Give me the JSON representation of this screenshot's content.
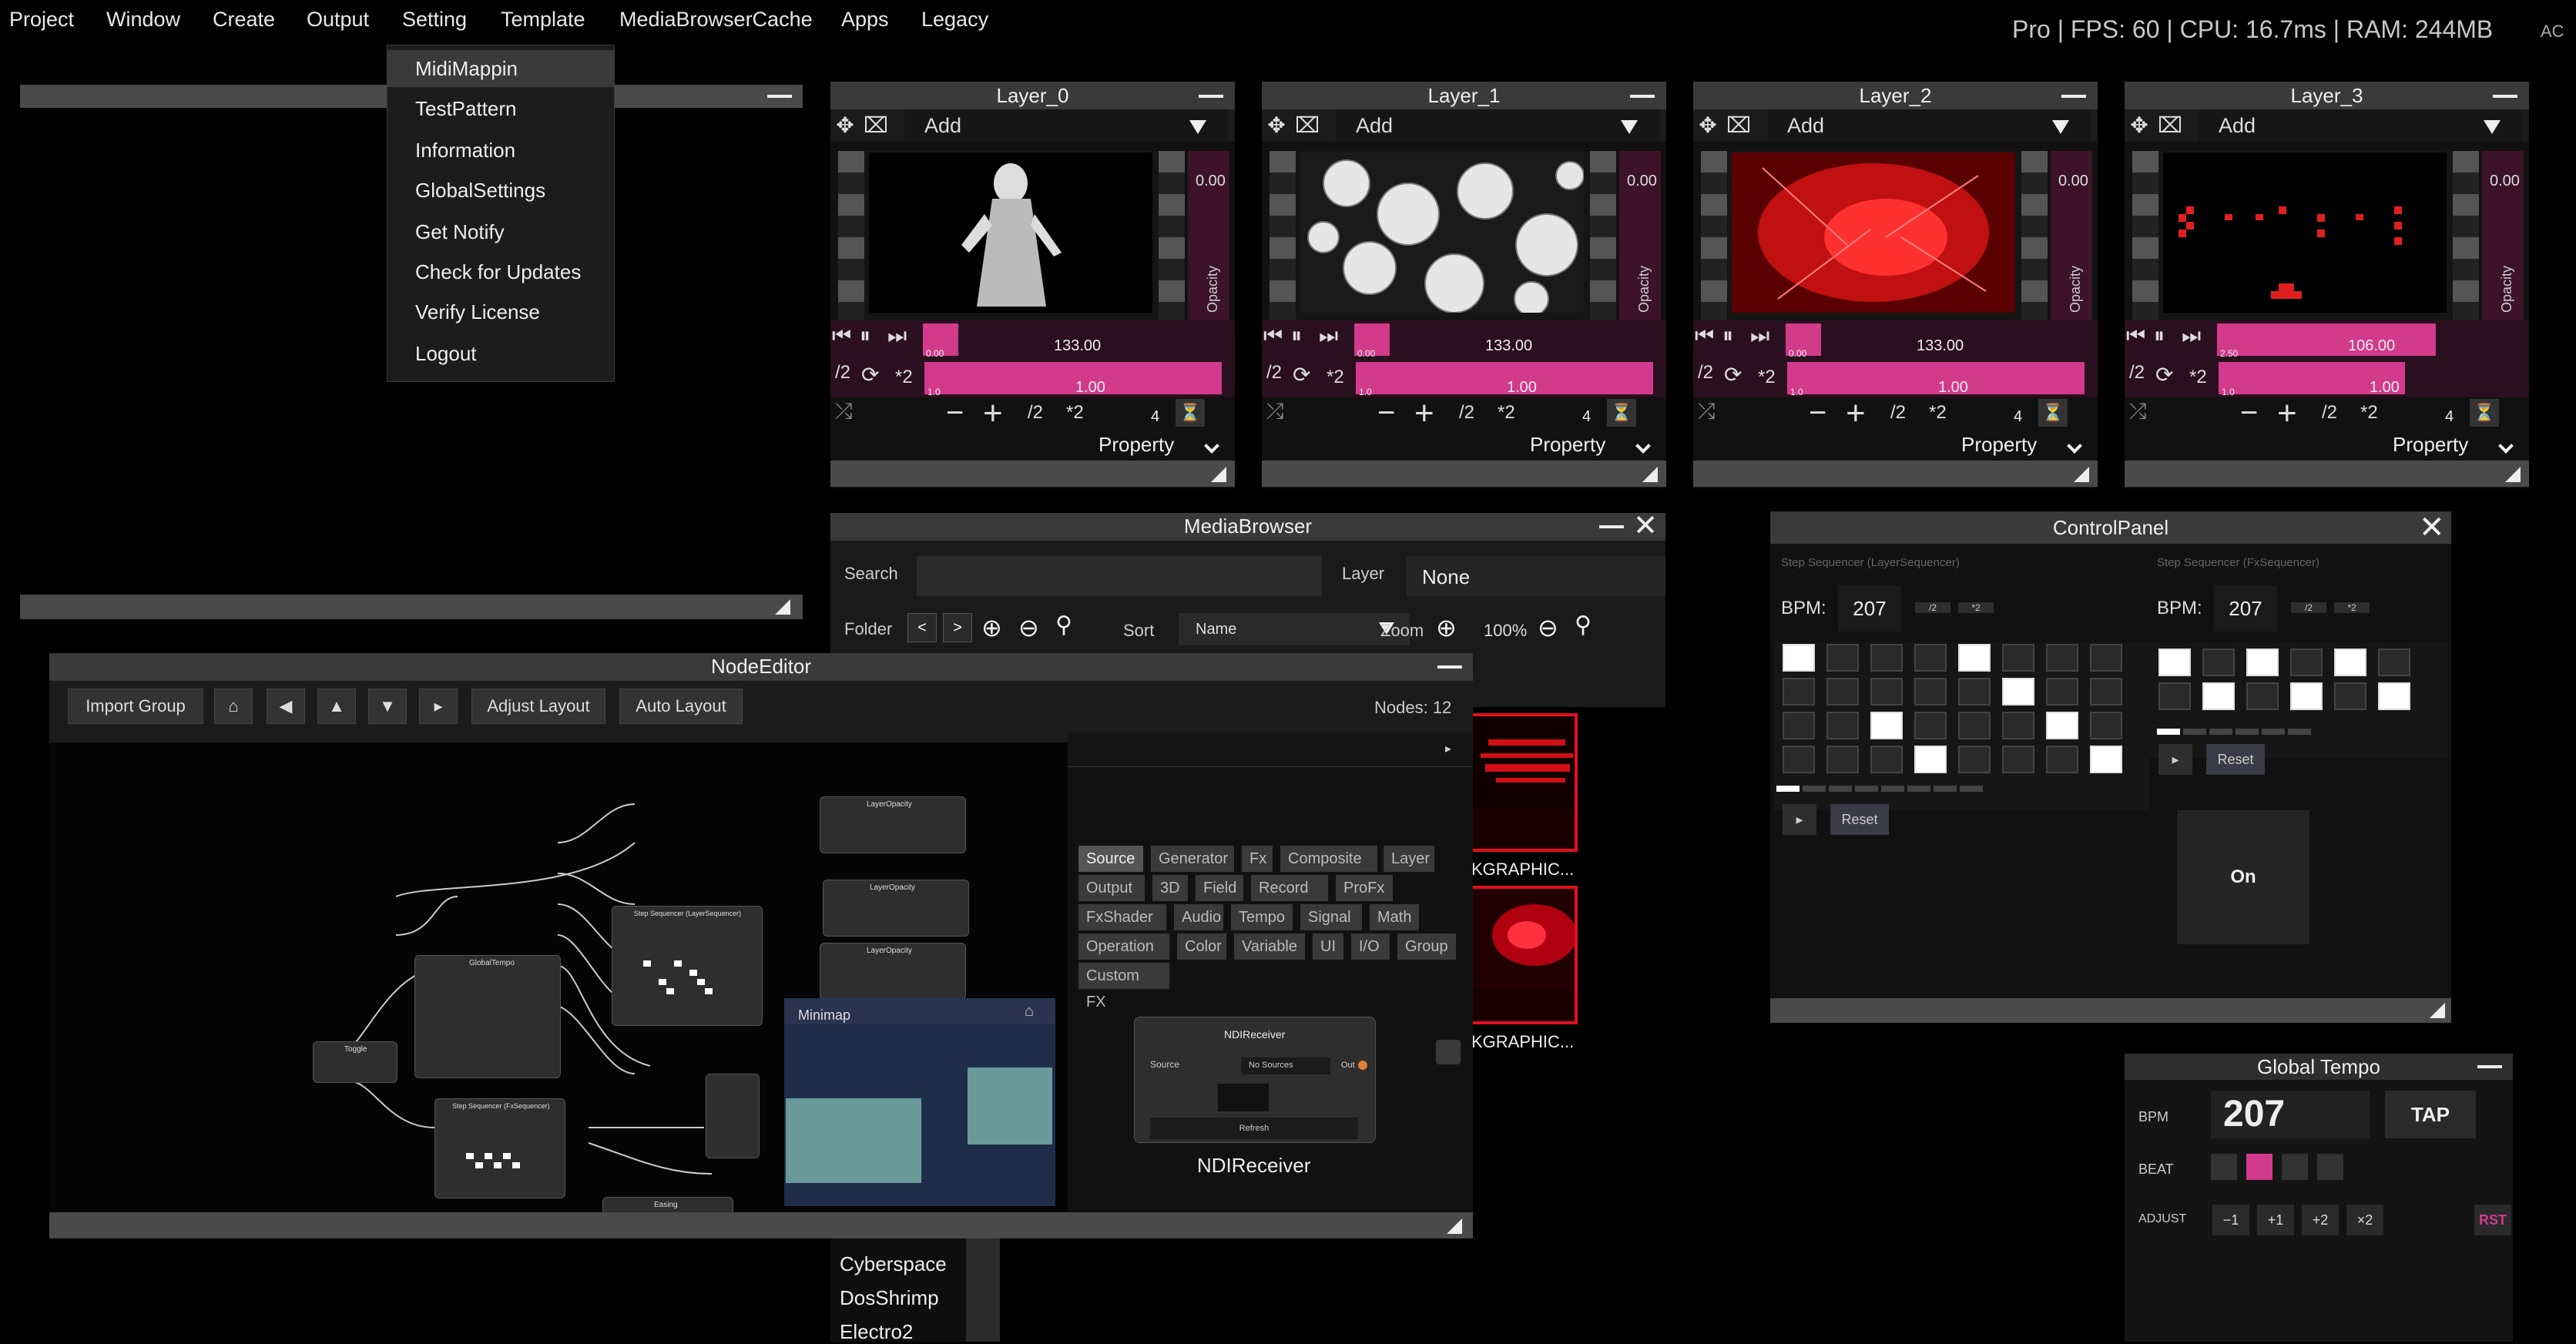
{
  "menubar": {
    "items": [
      "Project",
      "Window",
      "Create",
      "Output",
      "Setting",
      "Template",
      "MediaBrowserCache",
      "Apps",
      "Legacy"
    ],
    "status": "Pro | FPS: 60 | CPU: 16.7ms | RAM: 244MB",
    "status_extra": "AC"
  },
  "setting_menu": [
    "MidiMappin",
    "TestPattern",
    "Information",
    "GlobalSettings",
    "Get Notify",
    "Check for Updates",
    "Verify License",
    "Logout"
  ],
  "layers": [
    {
      "title": "Layer_0",
      "add": "Add",
      "opacity": "0.00",
      "opacity_label": "Opacity",
      "speed": "133.00",
      "ratio": "1.00",
      "half": "/2",
      "double": "*2",
      "count": "4",
      "property": "Property",
      "mini1": "0.00",
      "mini2": "1.0"
    },
    {
      "title": "Layer_1",
      "add": "Add",
      "opacity": "0.00",
      "opacity_label": "Opacity",
      "speed": "133.00",
      "ratio": "1.00",
      "half": "/2",
      "double": "*2",
      "count": "4",
      "property": "Property",
      "mini1": "0.00",
      "mini2": "1.0"
    },
    {
      "title": "Layer_2",
      "add": "Add",
      "opacity": "0.00",
      "opacity_label": "Opacity",
      "speed": "133.00",
      "ratio": "1.00",
      "half": "/2",
      "double": "*2",
      "count": "4",
      "property": "Property",
      "mini1": "0.00",
      "mini2": "1.0"
    },
    {
      "title": "Layer_3",
      "add": "Add",
      "opacity": "0.00",
      "opacity_label": "Opacity",
      "speed": "106.00",
      "ratio": "1.00",
      "half": "/2",
      "double": "*2",
      "count": "4",
      "property": "Property",
      "mini1": "2.50",
      "mini2": "1.0"
    }
  ],
  "media_browser": {
    "title": "MediaBrowser",
    "search_label": "Search",
    "search_value": "",
    "layer_label": "Layer",
    "layer_value": "None",
    "folder_label": "Folder",
    "prev": "<",
    "next": ">",
    "sort_label": "Sort",
    "sort_value": "Name",
    "zoom_label": "Zoom",
    "zoom_value": "100%",
    "thumb1_label": "KGRAPHIC...",
    "thumb2_label": "KGRAPHIC...",
    "files": [
      "Cyberspace",
      "DosShrimp",
      "Electro2"
    ]
  },
  "node_editor": {
    "title": "NodeEditor",
    "import_group": "Import Group",
    "home": "⌂",
    "left": "◀",
    "up": "▲",
    "down": "▼",
    "right": "▸",
    "adjust_layout": "Adjust Layout",
    "auto_layout": "Auto Layout",
    "nodes_count": "Nodes: 12",
    "minimap": "Minimap",
    "minimap_home": "⌂",
    "category_tags": [
      "Source",
      "Generator",
      "Fx",
      "Composite",
      "Layer",
      "Output",
      "3D",
      "Field",
      "Record",
      "ProFx",
      "FxShader",
      "Audio",
      "Tempo",
      "Signal",
      "Math",
      "Operation",
      "Color",
      "Variable",
      "UI",
      "I/O",
      "Group",
      "Custom FX"
    ],
    "ndi_node_title": "NDIReceiver",
    "ndi_source_label": "Source",
    "ndi_source_value": "No Sources",
    "ndi_out": "Out",
    "ndi_refresh": "Refresh",
    "ndi_caption": "NDIReceiver",
    "node_titles": [
      "GlobalTempo",
      "Step Sequencer (LayerSequencer)",
      "LayerOpacity",
      "LayerOpacity",
      "LayerOpacity",
      "Toggle",
      "Step Sequencer (FxSequencer)",
      "Easing"
    ]
  },
  "control_panel": {
    "title": "ControlPanel",
    "left_label": "Step Sequencer (LayerSequencer)",
    "right_label": "Step Sequencer (FxSequencer)",
    "bpm_label": "BPM:",
    "bpm_left": "207",
    "bpm_right": "207",
    "half": "/2",
    "double": "*2",
    "play": "▸",
    "reset": "Reset",
    "on": "On",
    "left_grid": [
      [
        1,
        0,
        0,
        0,
        1,
        0,
        0,
        0
      ],
      [
        0,
        0,
        0,
        0,
        0,
        1,
        0,
        0
      ],
      [
        0,
        0,
        1,
        0,
        0,
        0,
        1,
        0
      ],
      [
        0,
        0,
        0,
        1,
        0,
        0,
        0,
        1
      ]
    ],
    "right_grid": [
      [
        1,
        0,
        1,
        0,
        1,
        0
      ],
      [
        0,
        1,
        0,
        1,
        0,
        1
      ]
    ]
  },
  "global_tempo": {
    "title": "Global Tempo",
    "bpm_label": "BPM",
    "bpm_value": "207",
    "tap": "TAP",
    "beat_label": "BEAT",
    "adjust_label": "ADJUST",
    "adj_buttons": [
      "−1",
      "+1",
      "+2",
      "×2"
    ],
    "rst": "RST",
    "beat_active": 1,
    "accent": "#d23a8c"
  }
}
